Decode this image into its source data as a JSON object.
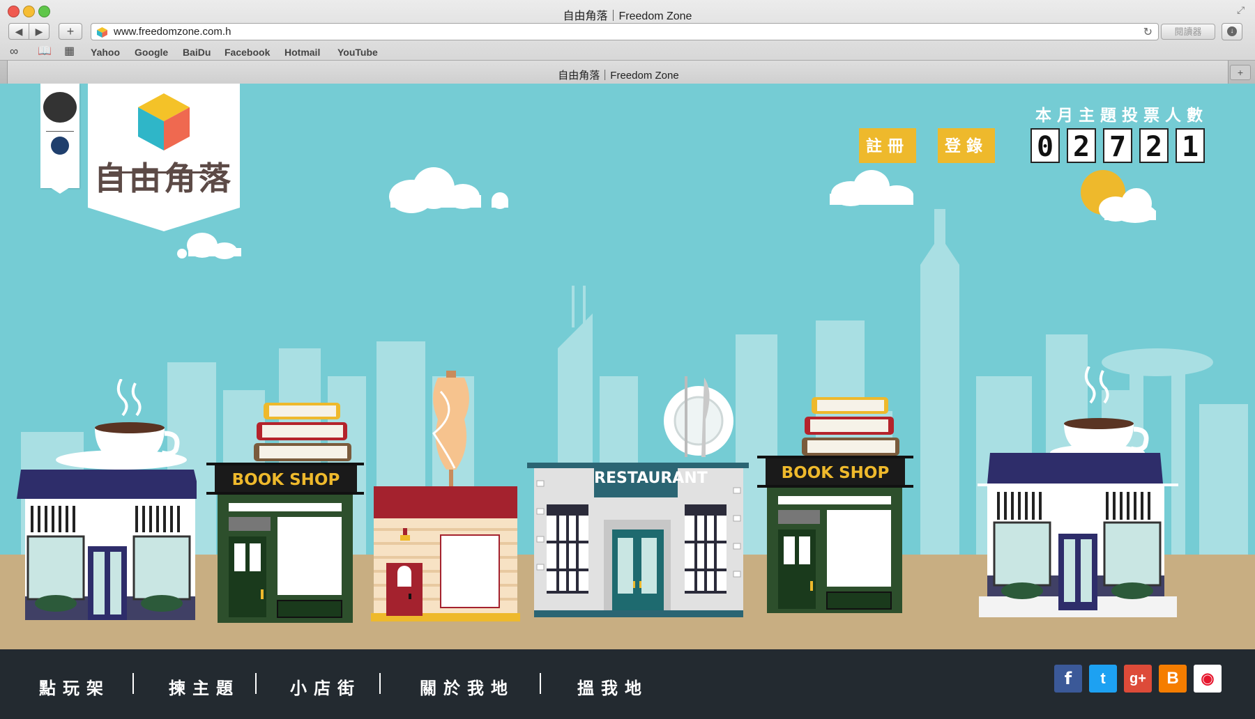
{
  "browser": {
    "window_title": "自由角落｜Freedom Zone",
    "url": "www.freedomzone.com.h",
    "reader_label": "閱讀器",
    "bookmarks": [
      "Yahoo",
      "Google",
      "BaiDu",
      "Facebook",
      "Hotmail",
      "YouTube"
    ],
    "tab_title": "自由角落｜Freedom Zone"
  },
  "site": {
    "logo_text": "自由角落",
    "register_label": "註冊",
    "login_label": "登錄",
    "vote_count_label": "本月主題投票人數",
    "vote_digits": [
      "0",
      "2",
      "7",
      "2",
      "1"
    ],
    "shops": {
      "bookshop_1": "BOOK SHOP",
      "restaurant": "RESTAURANT",
      "bookshop_2": "BOOK SHOP"
    },
    "nav": [
      "點玩架",
      "揀主題",
      "小店街",
      "關於我地",
      "搵我地"
    ],
    "social_icons": [
      "facebook-icon",
      "twitter-icon",
      "google-plus-icon",
      "blogger-icon",
      "weibo-icon"
    ]
  },
  "colors": {
    "sky": "#75ccd4",
    "accent_yellow": "#eeb92c",
    "footer": "#232a30",
    "ground": "#c8ae82"
  }
}
